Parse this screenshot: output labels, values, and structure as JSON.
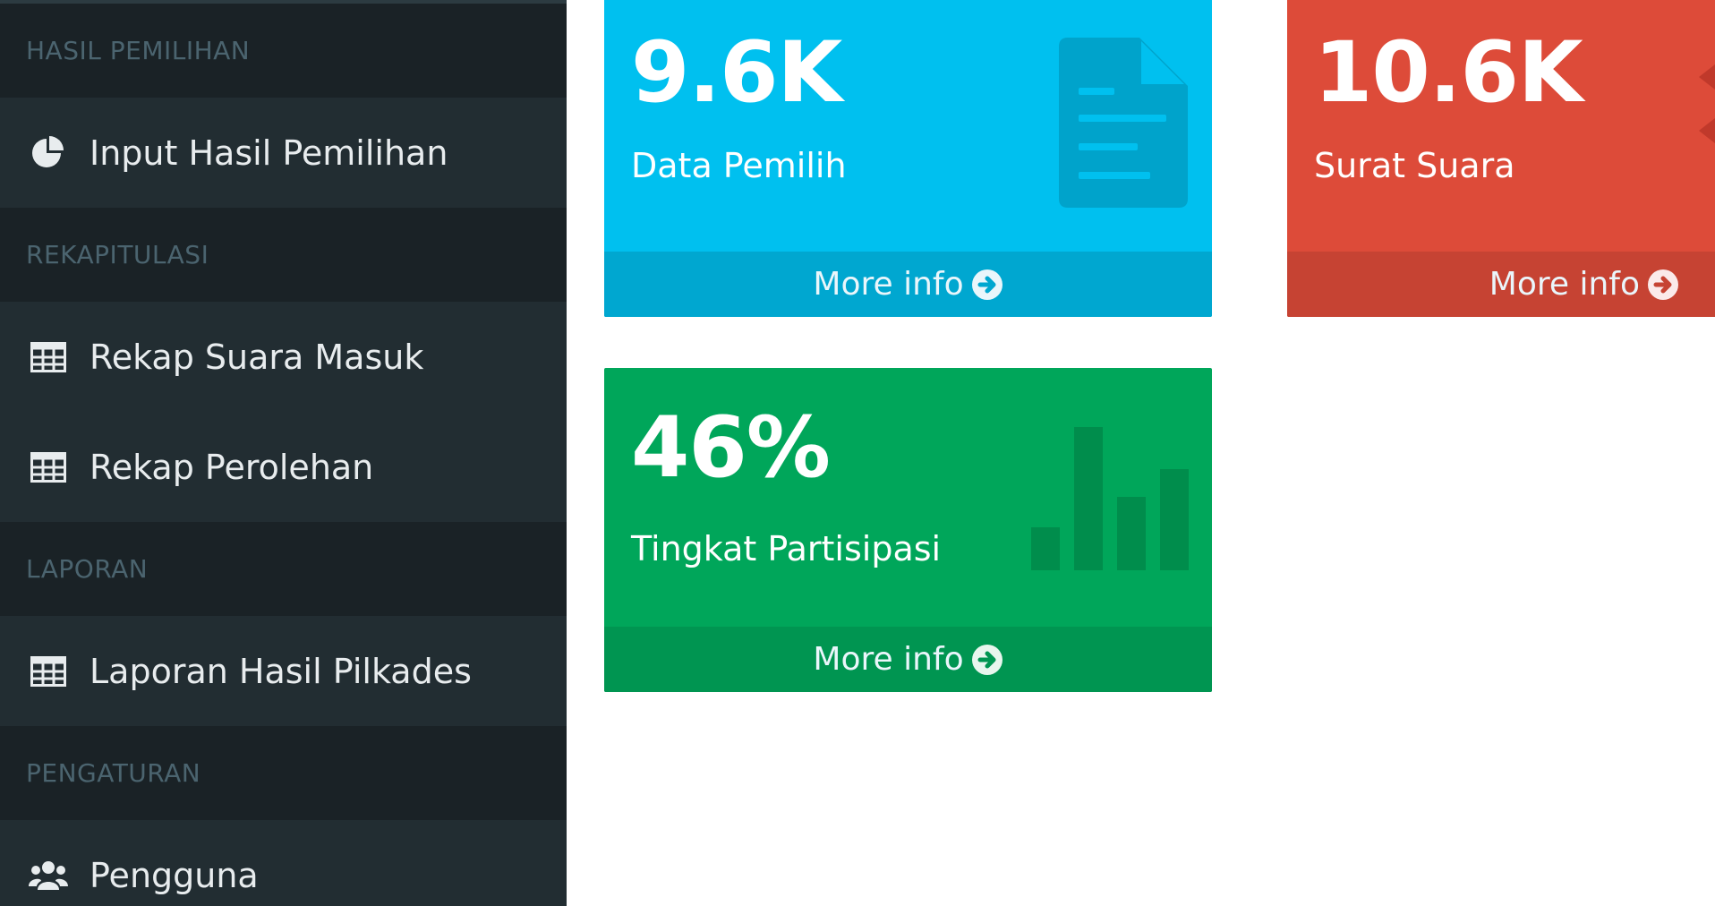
{
  "sidebar": {
    "sections": [
      {
        "header": "HASIL PEMILIHAN",
        "items": [
          {
            "label": "Input Hasil Pemilihan",
            "icon": "pie-chart-icon"
          }
        ]
      },
      {
        "header": "REKAPITULASI",
        "items": [
          {
            "label": "Rekap Suara Masuk",
            "icon": "table-icon"
          },
          {
            "label": "Rekap Perolehan",
            "icon": "table-icon"
          }
        ]
      },
      {
        "header": "LAPORAN",
        "items": [
          {
            "label": "Laporan Hasil Pilkades",
            "icon": "table-icon"
          }
        ]
      },
      {
        "header": "PENGATURAN",
        "items": [
          {
            "label": "Pengguna",
            "icon": "users-icon"
          }
        ]
      }
    ]
  },
  "boxes": {
    "data_pemilih": {
      "value": "9.6K",
      "label": "Data Pemilih",
      "footer": "More info",
      "icon": "document-icon",
      "color": "#00c0ef",
      "footer_color": "#00a7d0"
    },
    "surat_suara": {
      "value": "10.6K",
      "label": "Surat Suara",
      "footer": "More info",
      "icon": "envelope-icon",
      "color": "#dd4b39",
      "footer_color": "#c64333"
    },
    "tingkat_partisipasi": {
      "value": "46%",
      "label": "Tingkat Partisipasi",
      "footer": "More info",
      "icon": "bar-chart-icon",
      "color": "#00a65a",
      "footer_color": "#009551"
    }
  }
}
